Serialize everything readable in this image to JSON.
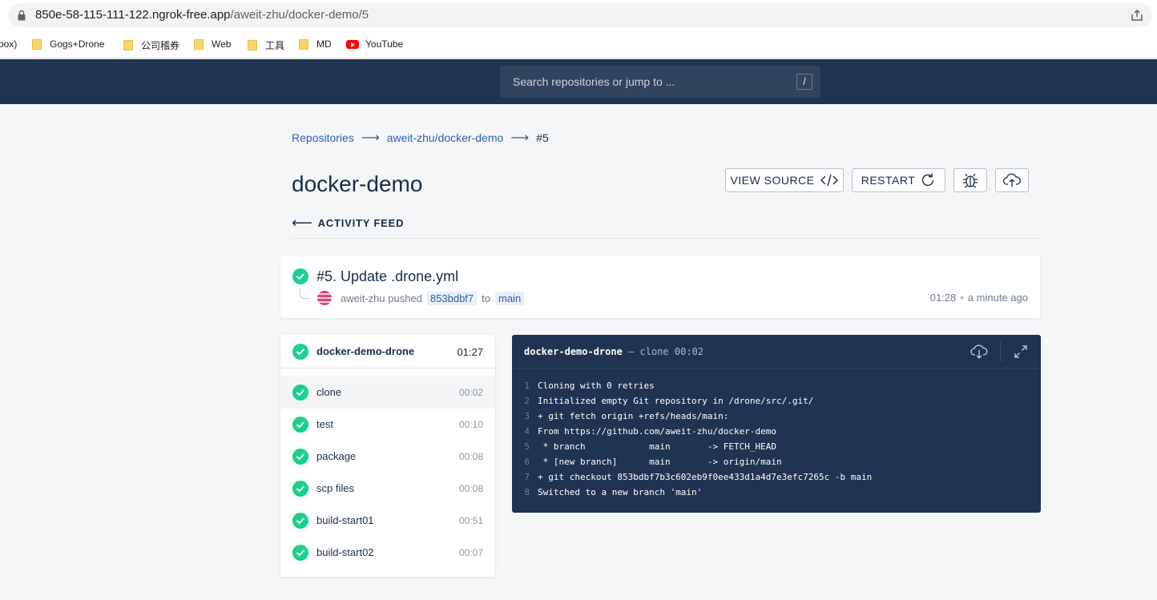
{
  "browser": {
    "url_host": "850e-58-115-111-122.ngrok-free.app",
    "url_path": "/aweit-zhu/docker-demo/5",
    "bookmarks": [
      {
        "label": "oox)",
        "icon": "none"
      },
      {
        "label": "Gogs+Drone",
        "icon": "folder-icon"
      },
      {
        "label": "公司稽券",
        "icon": "folder-icon"
      },
      {
        "label": "Web",
        "icon": "folder-icon"
      },
      {
        "label": "工具",
        "icon": "folder-icon"
      },
      {
        "label": "MD",
        "icon": "folder-icon"
      },
      {
        "label": "YouTube",
        "icon": "youtube-icon"
      }
    ]
  },
  "header": {
    "search_placeholder": "Search repositories or jump to ...",
    "search_shortcut": "/"
  },
  "breadcrumb": {
    "root": "Repositories",
    "repo": "aweit-zhu/docker-demo",
    "current": "#5"
  },
  "page": {
    "title": "docker-demo",
    "view_source_label": "VIEW SOURCE",
    "restart_label": "RESTART",
    "activity_label": "ACTIVITY FEED"
  },
  "build": {
    "title": "#5. Update .drone.yml",
    "author": "aweit-zhu",
    "action": "pushed",
    "commit": "853bdbf7",
    "to_word": "to",
    "branch": "main",
    "duration": "01:28",
    "time_ago": "a minute ago",
    "status_color": "#19d28e"
  },
  "stage": {
    "name": "docker-demo-drone",
    "duration": "01:27",
    "steps": [
      {
        "name": "clone",
        "duration": "00:02"
      },
      {
        "name": "test",
        "duration": "00:10"
      },
      {
        "name": "package",
        "duration": "00:08"
      },
      {
        "name": "scp files",
        "duration": "00:08"
      },
      {
        "name": "build-start01",
        "duration": "00:51"
      },
      {
        "name": "build-start02",
        "duration": "00:07"
      }
    ]
  },
  "log": {
    "stage": "docker-demo-drone",
    "separator": "—",
    "step": "clone",
    "duration": "00:02",
    "lines": [
      {
        "n": "1",
        "text": "Cloning with 0 retries"
      },
      {
        "n": "2",
        "text": "Initialized empty Git repository in /drone/src/.git/"
      },
      {
        "n": "3",
        "text": "+ git fetch origin +refs/heads/main:"
      },
      {
        "n": "4",
        "text": "From https://github.com/aweit-zhu/docker-demo"
      },
      {
        "n": "5",
        "text": " * branch            main       -> FETCH_HEAD"
      },
      {
        "n": "6",
        "text": " * [new branch]      main       -> origin/main"
      },
      {
        "n": "7",
        "text": "+ git checkout 853bdbf7b3c602eb9f0ee433d1a4d7e3efc7265c -b main"
      },
      {
        "n": "8",
        "text": "Switched to a new branch 'main'"
      }
    ]
  }
}
